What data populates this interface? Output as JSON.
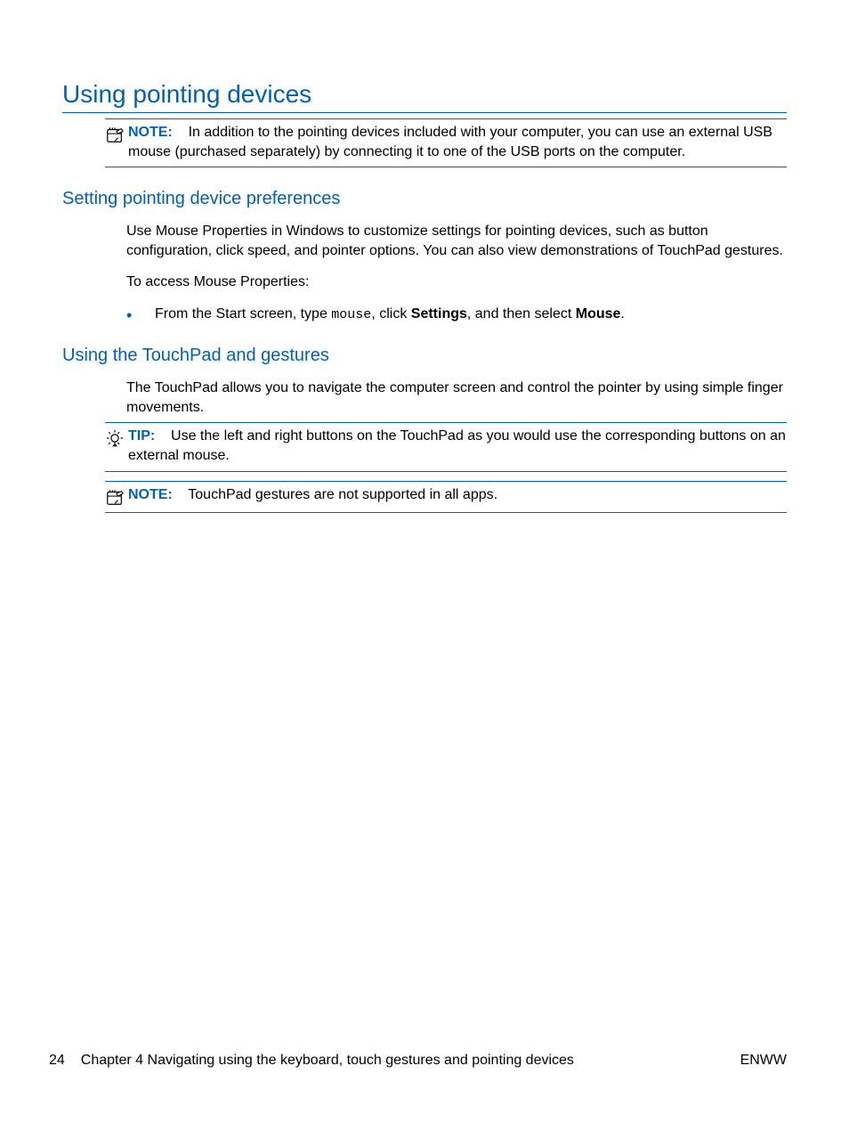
{
  "headings": {
    "h1": "Using pointing devices",
    "h2a": "Setting pointing device preferences",
    "h2b": "Using the TouchPad and gestures"
  },
  "notes": {
    "note1": {
      "label": "NOTE:",
      "text": "In addition to the pointing devices included with your computer, you can use an external USB mouse (purchased separately) by connecting it to one of the USB ports on the computer."
    },
    "tip1": {
      "label": "TIP:",
      "text": "Use the left and right buttons on the TouchPad as you would use the corresponding buttons on an external mouse."
    },
    "note2": {
      "label": "NOTE:",
      "text": "TouchPad gestures are not supported in all apps."
    }
  },
  "paragraphs": {
    "p1": "Use Mouse Properties in Windows to customize settings for pointing devices, such as button configuration, click speed, and pointer options. You can also view demonstrations of TouchPad gestures.",
    "p2": "To access Mouse Properties:",
    "p3": "The TouchPad allows you to navigate the computer screen and control the pointer by using simple finger movements."
  },
  "bullet": {
    "pre": "From the Start screen, type ",
    "mono": "mouse",
    "mid1": ", click ",
    "bold1": "Settings",
    "mid2": ", and then select ",
    "bold2": "Mouse",
    "post": "."
  },
  "footer": {
    "page": "24",
    "chapter": "Chapter 4   Navigating using the keyboard, touch gestures and pointing devices",
    "lang": "ENWW"
  }
}
